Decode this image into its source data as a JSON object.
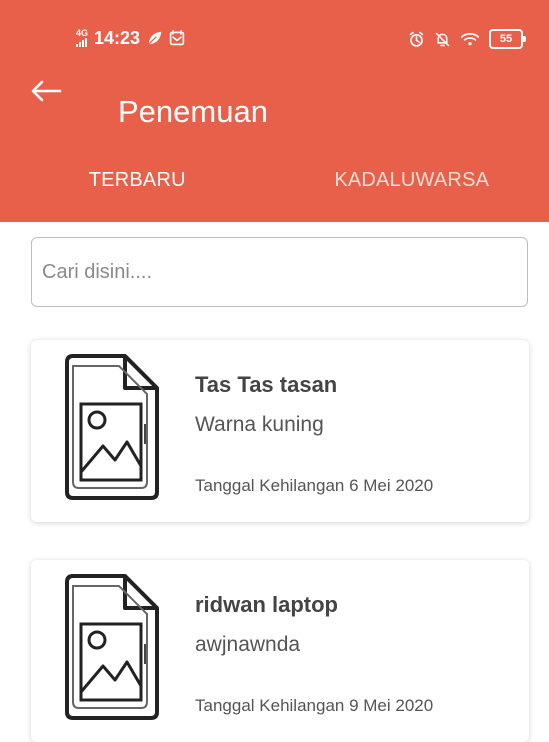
{
  "status_bar": {
    "network": "4G",
    "time": "14:23",
    "battery": "55"
  },
  "app_bar": {
    "title": "Penemuan"
  },
  "tabs": [
    {
      "label": "TERBARU",
      "active": true
    },
    {
      "label": "KADALUWARSA",
      "active": false
    }
  ],
  "search": {
    "value": "",
    "placeholder": "Cari disini...."
  },
  "items": [
    {
      "title": "Tas Tas tasan",
      "description": "Warna kuning",
      "date": "Tanggal Kehilangan 6 Mei 2020"
    },
    {
      "title": "ridwan laptop",
      "description": "awjnawnda",
      "date": "Tanggal Kehilangan 9 Mei 2020"
    }
  ],
  "colors": {
    "primary": "#e8604a",
    "text": "#444444",
    "muted": "#555555",
    "border": "#bdbdbd"
  },
  "icons": {
    "back": "arrow-left-icon",
    "placeholder": "image-file-icon"
  }
}
